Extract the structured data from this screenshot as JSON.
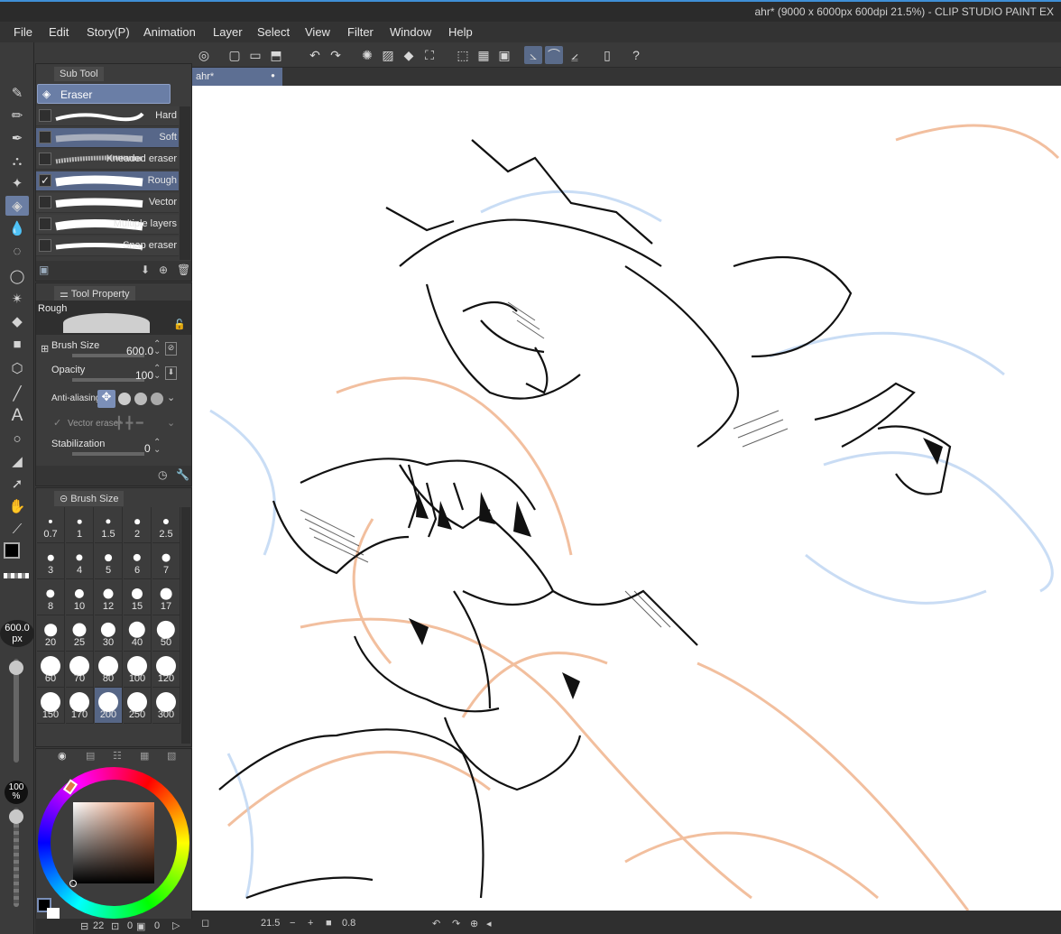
{
  "window": {
    "title": "ahr* (9000 x 6000px 600dpi 21.5%)  - CLIP STUDIO PAINT EX"
  },
  "menu": [
    "File",
    "Edit",
    "Story(P)",
    "Animation",
    "Layer",
    "Select",
    "View",
    "Filter",
    "Window",
    "Help"
  ],
  "document_tab": {
    "label": "ahr*",
    "dot": "●"
  },
  "sub_tool": {
    "tab": "Sub Tool",
    "group": "Eraser",
    "items": [
      {
        "label": "Hard",
        "checked": false,
        "selected": false
      },
      {
        "label": "Soft",
        "checked": false,
        "selected": true
      },
      {
        "label": "Kneaded eraser",
        "checked": false,
        "selected": false
      },
      {
        "label": "Rough",
        "checked": true,
        "selected": true
      },
      {
        "label": "Vector",
        "checked": false,
        "selected": false
      },
      {
        "label": "Multiple layers",
        "checked": false,
        "selected": false
      },
      {
        "label": "Snap eraser",
        "checked": false,
        "selected": false
      }
    ]
  },
  "tool_property": {
    "tab": "Tool Property",
    "preset": "Rough",
    "brush_size_label": "Brush Size",
    "brush_size_value": "600.0",
    "opacity_label": "Opacity",
    "opacity_value": "100",
    "antialiasing_label": "Anti-aliasing",
    "vector_eraser_label": "Vector eraser",
    "stabilization_label": "Stabilization",
    "stabilization_value": "0"
  },
  "brush_size": {
    "tab": "Brush Size",
    "sizes": [
      "0.7",
      "1",
      "1.5",
      "2",
      "2.5",
      "3",
      "4",
      "5",
      "6",
      "7",
      "8",
      "10",
      "12",
      "15",
      "17",
      "20",
      "25",
      "30",
      "40",
      "50",
      "60",
      "70",
      "80",
      "100",
      "120",
      "150",
      "170",
      "200",
      "250",
      "300"
    ],
    "selected": "200"
  },
  "left_strip": {
    "brush_size_display": "600.0",
    "unit": "px",
    "opacity_display": "100",
    "opacity_unit": "%"
  },
  "colors": {
    "main": "#000000",
    "sub": "#ffffff",
    "accent": "#6b7ea3",
    "hue_marker": "#e07a4a"
  },
  "status": {
    "zoom": "21.5",
    "angle": "0.8",
    "layer_count": "22",
    "a": "0",
    "b": "0"
  }
}
